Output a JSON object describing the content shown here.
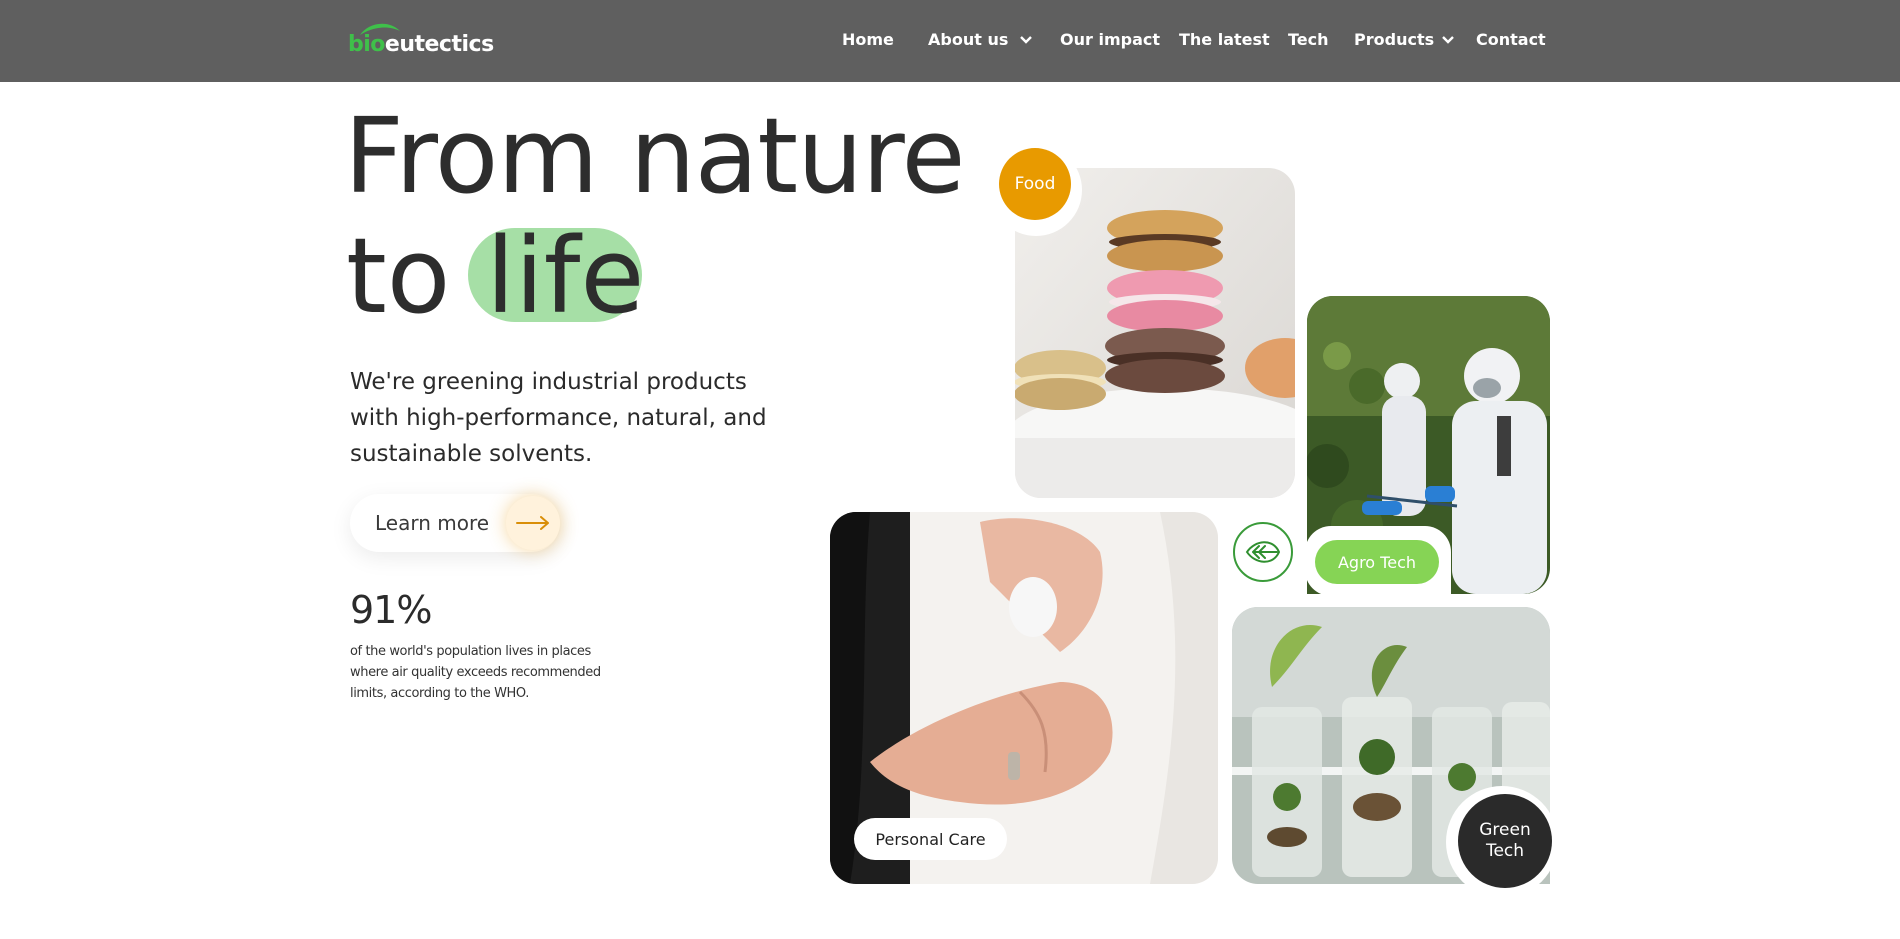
{
  "header": {
    "logo": {
      "part1": "bio",
      "part2": "eutectics"
    },
    "nav": [
      {
        "label": "Home",
        "has_dropdown": false
      },
      {
        "label": "About us",
        "has_dropdown": true
      },
      {
        "label": "Our impact",
        "has_dropdown": false
      },
      {
        "label": "The latest",
        "has_dropdown": false
      },
      {
        "label": "Tech",
        "has_dropdown": false
      },
      {
        "label": "Products",
        "has_dropdown": true
      },
      {
        "label": "Contact",
        "has_dropdown": false
      }
    ]
  },
  "hero": {
    "line1": "From nature",
    "line2_word1": "to",
    "line2_word2": "life",
    "lede": "We're greening industrial products with high-performance, natural, and sustainable solvents.",
    "cta": "Learn more",
    "stat_value": "91%",
    "stat_note": "of the world's population lives in places where air quality exceeds recommended limits, according to the WHO."
  },
  "tiles": {
    "food": "Food",
    "agro": "Agro Tech",
    "personal_care": "Personal Care",
    "green_tech_line1": "Green",
    "green_tech_line2": "Tech"
  },
  "colors": {
    "header_bg": "#5f5f5f",
    "highlight": "#a6dfa6",
    "food": "#e89a00",
    "agro": "#86d455",
    "green_tech": "#2a2a2a",
    "brand_green": "#3fc04a"
  },
  "icons": [
    "logo-leaf-icon",
    "chevron-down-icon",
    "arrow-right-icon",
    "leaf-arrows-icon"
  ]
}
